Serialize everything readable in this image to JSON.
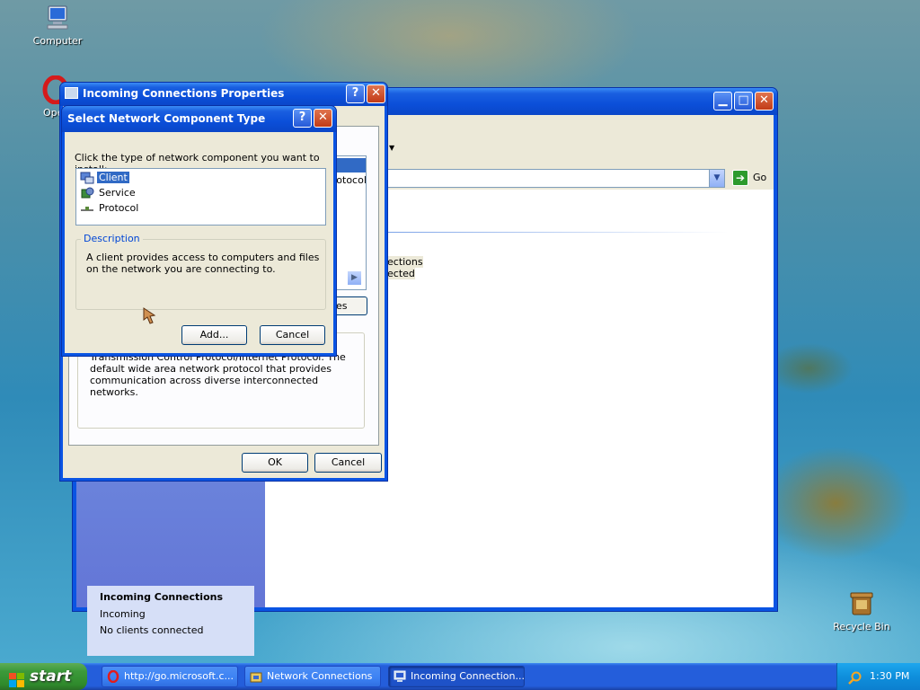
{
  "desktop": {
    "icons": [
      {
        "label": "Computer"
      },
      {
        "label": "Ope"
      },
      {
        "label": "Recycle Bin"
      }
    ]
  },
  "network_connections": {
    "title": "",
    "go_label": "Go",
    "fragments": {
      "line1": "ections",
      "line2": "ected",
      "props": "es"
    },
    "details": {
      "name": "Incoming Connections",
      "type": "Incoming",
      "status": "No clients connected"
    }
  },
  "properties_dialog": {
    "title": "Incoming Connections Properties",
    "list_fragment": "rotocol",
    "description": "Transmission Control Protocol/Internet Protocol. The default wide area network protocol that provides communication across diverse interconnected networks.",
    "ok_label": "OK",
    "cancel_label": "Cancel"
  },
  "select_dialog": {
    "title": "Select Network Component Type",
    "prompt": "Click the type of network component you want to install:",
    "items": [
      {
        "label": "Client",
        "selected": true
      },
      {
        "label": "Service",
        "selected": false
      },
      {
        "label": "Protocol",
        "selected": false
      }
    ],
    "description_title": "Description",
    "description": "A client provides access to computers and files on the network you are connecting to.",
    "add_label": "Add...",
    "cancel_label": "Cancel"
  },
  "taskbar": {
    "start_label": "start",
    "tasks": [
      {
        "label": "http://go.microsoft.c...",
        "icon": "opera-icon"
      },
      {
        "label": "Network Connections",
        "icon": "network-folder-icon"
      },
      {
        "label": "Incoming Connection...",
        "icon": "incoming-connection-icon",
        "active": true
      }
    ],
    "clock": "1:30 PM"
  },
  "colors": {
    "title_blue": "#0a54e3",
    "start_green": "#3c9a3a",
    "selection": "#316ac5"
  }
}
